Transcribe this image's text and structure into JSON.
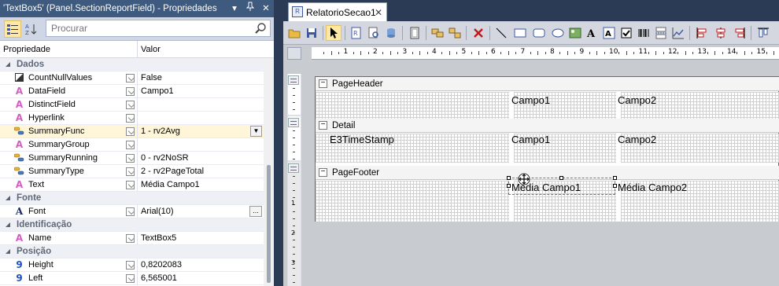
{
  "props_panel": {
    "title": "'TextBox5' (Panel.SectionReportField) - Propriedades",
    "title_buttons": [
      "▾",
      "ꟼ",
      "✕"
    ],
    "search_placeholder": "Procurar",
    "col_property": "Propriedade",
    "col_value": "Valor",
    "rows": [
      {
        "kind": "category",
        "label": "Dados"
      },
      {
        "kind": "prop",
        "icon": "checkbox-icon",
        "name": "CountNullValues",
        "value": "False"
      },
      {
        "kind": "prop",
        "icon": "text-a-icon",
        "name": "DataField",
        "value": "Campo1"
      },
      {
        "kind": "prop",
        "icon": "text-a-icon",
        "name": "DistinctField",
        "value": ""
      },
      {
        "kind": "prop",
        "icon": "text-a-icon",
        "name": "Hyperlink",
        "value": ""
      },
      {
        "kind": "prop",
        "icon": "enum-icon",
        "name": "SummaryFunc",
        "value": "1 - rv2Avg",
        "selected": true
      },
      {
        "kind": "prop",
        "icon": "text-a-icon",
        "name": "SummaryGroup",
        "value": ""
      },
      {
        "kind": "prop",
        "icon": "enum-icon",
        "name": "SummaryRunning",
        "value": "0 - rv2NoSR"
      },
      {
        "kind": "prop",
        "icon": "enum-icon",
        "name": "SummaryType",
        "value": "2 - rv2PageTotal"
      },
      {
        "kind": "prop",
        "icon": "text-a-icon",
        "name": "Text",
        "value": "Média Campo1"
      },
      {
        "kind": "category",
        "label": "Fonte"
      },
      {
        "kind": "prop",
        "icon": "font-a-icon",
        "name": "Font",
        "value": "Arial(10)",
        "ellipsis": true
      },
      {
        "kind": "category",
        "label": "Identificação"
      },
      {
        "kind": "prop",
        "icon": "text-a-icon",
        "name": "Name",
        "value": "TextBox5"
      },
      {
        "kind": "category",
        "label": "Posição"
      },
      {
        "kind": "prop",
        "icon": "number-9-icon",
        "name": "Height",
        "value": "0,8202083"
      },
      {
        "kind": "prop",
        "icon": "number-9-icon",
        "name": "Left",
        "value": "6,565001"
      }
    ]
  },
  "document": {
    "tab_label": "RelatorioSecao1",
    "tab_close": "✕",
    "ruler_numbers": [
      "1",
      "2",
      "3",
      "4",
      "5",
      "6",
      "7",
      "8",
      "9",
      "10",
      "11",
      "12",
      "13",
      "14",
      "15"
    ],
    "vruler_numbers": [
      "1",
      "2",
      "3"
    ],
    "sections": [
      {
        "label": "PageHeader",
        "fields": [
          "Campo1",
          "Campo2"
        ]
      },
      {
        "label": "Detail",
        "fields": [
          "E3TimeStamp",
          "Campo1",
          "Campo2"
        ]
      },
      {
        "label": "PageFooter",
        "fields": [
          "Média Campo1",
          "Média Campo2"
        ]
      }
    ]
  },
  "colors": {
    "title_bar": "#3e5a7e",
    "background": "#2b3a55",
    "selected_row": "#fff5d9",
    "active_tool": "#ffe8a6"
  }
}
